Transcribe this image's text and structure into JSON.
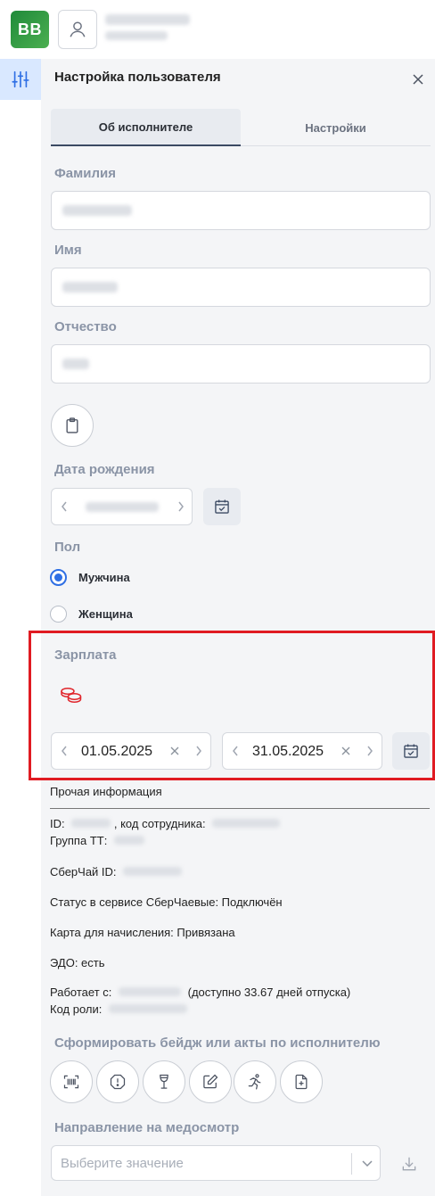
{
  "app": {
    "logo_text": "BB"
  },
  "panel": {
    "title": "Настройка пользователя",
    "tabs": [
      {
        "label": "Об исполнителе",
        "active": true
      },
      {
        "label": "Настройки",
        "active": false
      }
    ]
  },
  "form": {
    "surname_label": "Фамилия",
    "name_label": "Имя",
    "patronymic_label": "Отчество",
    "birth_label": "Дата рождения",
    "gender_label": "Пол",
    "gender_options": [
      {
        "label": "Мужчина",
        "checked": true
      },
      {
        "label": "Женщина",
        "checked": false
      }
    ]
  },
  "salary": {
    "label": "Зарплата",
    "date_from": "01.05.2025",
    "date_to": "31.05.2025"
  },
  "info": {
    "title": "Прочая информация",
    "id_label": "ID:",
    "employee_code_label": ", код сотрудника:",
    "group_label": "Группа ТТ:",
    "sbertea_id_label": "СберЧай ID:",
    "status_line": "Статус в сервисе СберЧаевые: Подключён",
    "card_line": "Карта для начисления: Привязана",
    "edo_line": "ЭДО: есть",
    "works_since_label": "Работает с:",
    "vacation_text": "(доступно 33.67 дней отпуска)",
    "role_code_label": "Код роли:"
  },
  "actions": {
    "title": "Сформировать бейдж или акты по исполнителю",
    "icons": [
      "barcode-icon",
      "alert-circle-icon",
      "wine-glass-icon",
      "edit-icon",
      "running-person-icon",
      "add-document-icon"
    ]
  },
  "medical": {
    "title": "Направление на медосмотр",
    "placeholder": "Выберите значение"
  },
  "colors": {
    "accent_blue": "#2f6fe4",
    "highlight_red": "#e01b22",
    "coins_red": "#e0252b",
    "label_gray": "#8a94a6"
  }
}
